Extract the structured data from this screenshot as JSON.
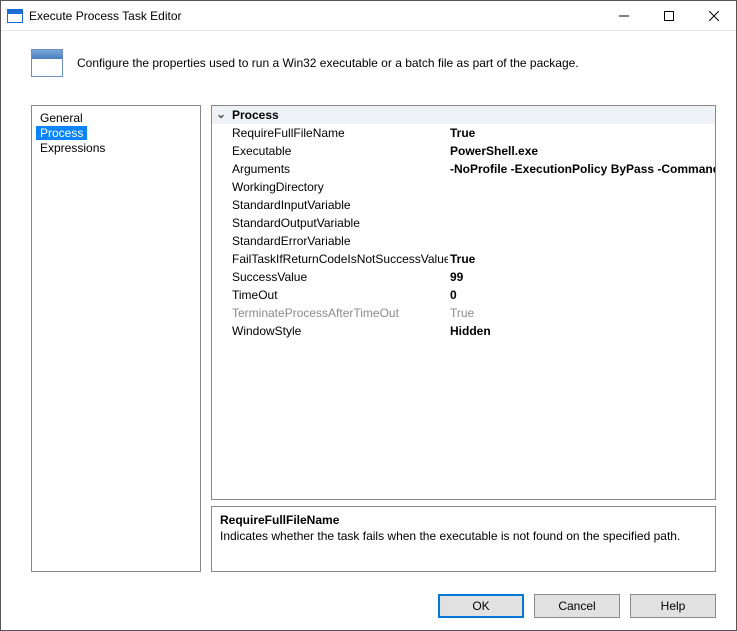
{
  "window": {
    "title": "Execute Process Task Editor"
  },
  "banner": {
    "text": "Configure the properties used to run a Win32 executable or a batch file as part of the package."
  },
  "nav": {
    "items": [
      {
        "label": "General",
        "selected": false
      },
      {
        "label": "Process",
        "selected": true
      },
      {
        "label": "Expressions",
        "selected": false
      }
    ]
  },
  "propgrid": {
    "category": "Process",
    "rows": [
      {
        "name": "RequireFullFileName",
        "value": "True",
        "bold": true
      },
      {
        "name": "Executable",
        "value": "PowerShell.exe",
        "bold": true
      },
      {
        "name": "Arguments",
        "value": "-NoProfile -ExecutionPolicy ByPass -Command ",
        "bold": true
      },
      {
        "name": "WorkingDirectory",
        "value": "",
        "bold": false
      },
      {
        "name": "StandardInputVariable",
        "value": "",
        "bold": false
      },
      {
        "name": "StandardOutputVariable",
        "value": "",
        "bold": false
      },
      {
        "name": "StandardErrorVariable",
        "value": "",
        "bold": false
      },
      {
        "name": "FailTaskIfReturnCodeIsNotSuccessValue",
        "value": "True",
        "bold": true
      },
      {
        "name": "SuccessValue",
        "value": "99",
        "bold": true
      },
      {
        "name": "TimeOut",
        "value": "0",
        "bold": true
      },
      {
        "name": "TerminateProcessAfterTimeOut",
        "value": "True",
        "bold": false,
        "disabled": true
      },
      {
        "name": "WindowStyle",
        "value": "Hidden",
        "bold": true
      }
    ]
  },
  "description": {
    "title": "RequireFullFileName",
    "text": "Indicates whether the task fails when the executable is not found on the specified path."
  },
  "buttons": {
    "ok": "OK",
    "cancel": "Cancel",
    "help": "Help"
  }
}
